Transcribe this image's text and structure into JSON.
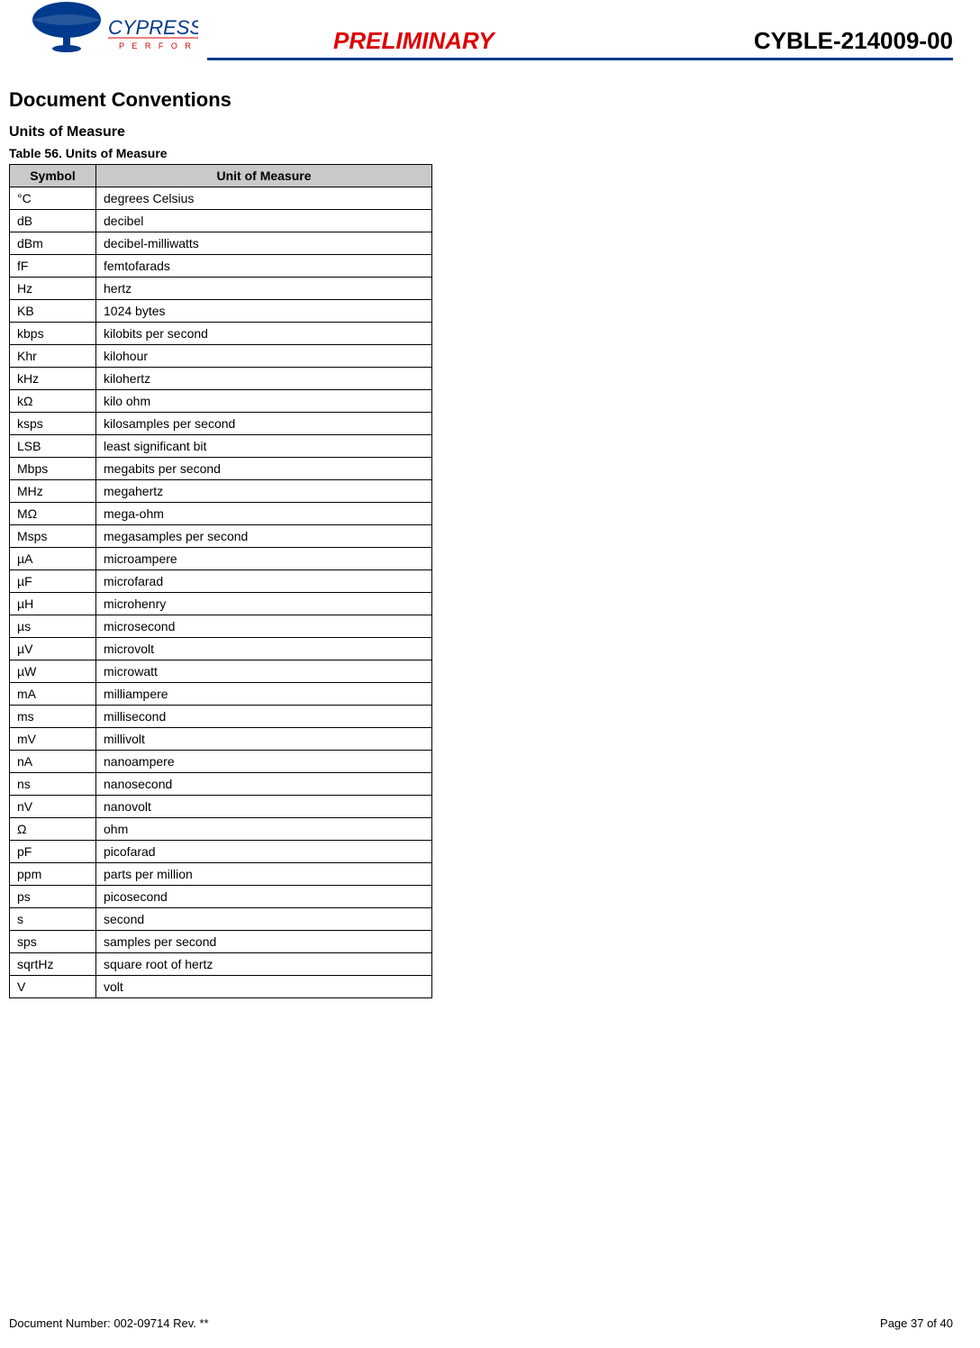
{
  "header": {
    "logo_brand": "CYPRESS",
    "logo_tagline": "P E R F O R M",
    "preliminary": "PRELIMINARY",
    "part_number": "CYBLE-214009-00"
  },
  "headings": {
    "h2": "Document Conventions",
    "h3": "Units of Measure",
    "table_caption": "Table 56.  Units of Measure"
  },
  "table": {
    "col_symbol": "Symbol",
    "col_unit": "Unit of Measure",
    "rows": [
      {
        "sym": "°C",
        "unit": "degrees Celsius"
      },
      {
        "sym": "dB",
        "unit": "decibel"
      },
      {
        "sym": "dBm",
        "unit": "decibel-milliwatts"
      },
      {
        "sym": "fF",
        "unit": "femtofarads"
      },
      {
        "sym": "Hz",
        "unit": "hertz"
      },
      {
        "sym": "KB",
        "unit": "1024 bytes"
      },
      {
        "sym": "kbps",
        "unit": "kilobits per second"
      },
      {
        "sym": "Khr",
        "unit": "kilohour"
      },
      {
        "sym": "kHz",
        "unit": "kilohertz"
      },
      {
        "sym": "kΩ",
        "unit": "kilo ohm"
      },
      {
        "sym": "ksps",
        "unit": "kilosamples per second"
      },
      {
        "sym": "LSB",
        "unit": "least significant bit"
      },
      {
        "sym": "Mbps",
        "unit": "megabits per second"
      },
      {
        "sym": "MHz",
        "unit": "megahertz"
      },
      {
        "sym": "MΩ",
        "unit": "mega-ohm"
      },
      {
        "sym": "Msps",
        "unit": "megasamples per second"
      },
      {
        "sym": "µA",
        "unit": "microampere"
      },
      {
        "sym": "µF",
        "unit": "microfarad"
      },
      {
        "sym": "µH",
        "unit": "microhenry"
      },
      {
        "sym": "µs",
        "unit": "microsecond"
      },
      {
        "sym": "µV",
        "unit": "microvolt"
      },
      {
        "sym": "µW",
        "unit": "microwatt"
      },
      {
        "sym": "mA",
        "unit": "milliampere"
      },
      {
        "sym": "ms",
        "unit": "millisecond"
      },
      {
        "sym": "mV",
        "unit": "millivolt"
      },
      {
        "sym": "nA",
        "unit": "nanoampere"
      },
      {
        "sym": "ns",
        "unit": "nanosecond"
      },
      {
        "sym": "nV",
        "unit": "nanovolt"
      },
      {
        "sym": "Ω",
        "unit": "ohm"
      },
      {
        "sym": "pF",
        "unit": "picofarad"
      },
      {
        "sym": "ppm",
        "unit": "parts per million"
      },
      {
        "sym": "ps",
        "unit": "picosecond"
      },
      {
        "sym": "s",
        "unit": "second"
      },
      {
        "sym": "sps",
        "unit": "samples per second"
      },
      {
        "sym": "sqrtHz",
        "unit": "square root of hertz"
      },
      {
        "sym": "V",
        "unit": "volt"
      }
    ]
  },
  "footer": {
    "docnum": "Document Number: 002-09714 Rev. **",
    "page": "Page 37 of 40"
  }
}
